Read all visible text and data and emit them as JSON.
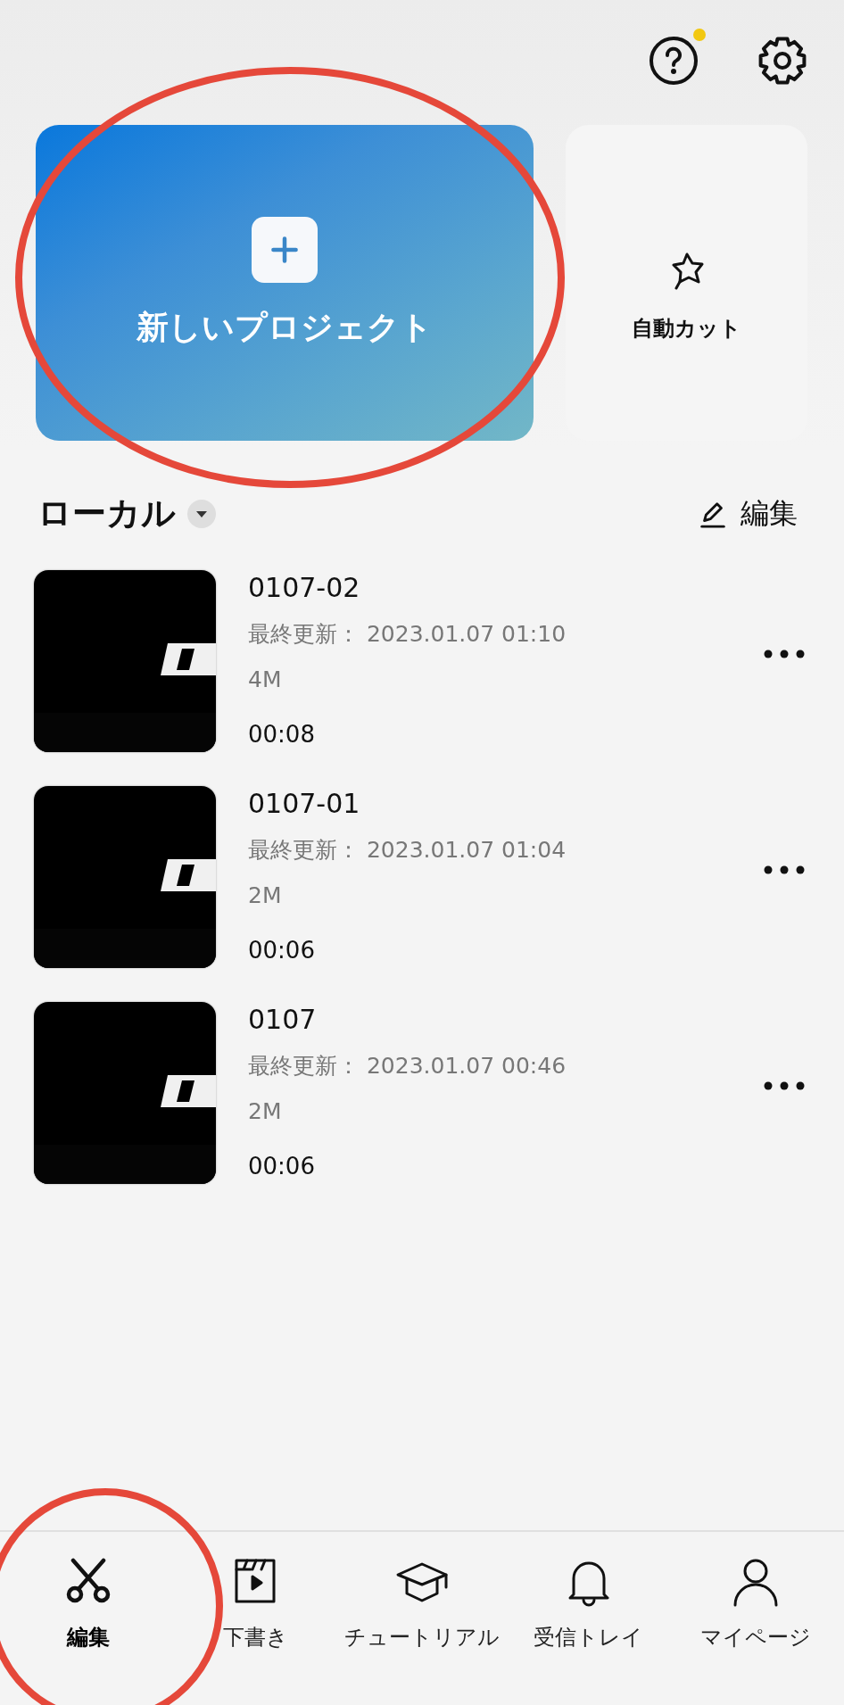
{
  "header": {
    "help_badge": true
  },
  "new_project": {
    "label": "新しいプロジェクト"
  },
  "auto_cut": {
    "label": "自動カット"
  },
  "section": {
    "title": "ローカル",
    "edit": "編集"
  },
  "projects": [
    {
      "name": "0107-02",
      "updated_label": "最終更新：",
      "updated": "2023.01.07 01:10",
      "size": "4M",
      "duration": "00:08"
    },
    {
      "name": "0107-01",
      "updated_label": "最終更新：",
      "updated": "2023.01.07 01:04",
      "size": "2M",
      "duration": "00:06"
    },
    {
      "name": "0107",
      "updated_label": "最終更新：",
      "updated": "2023.01.07 00:46",
      "size": "2M",
      "duration": "00:06"
    }
  ],
  "tab_bar": [
    {
      "label": "編集",
      "kind": "scissors",
      "selected": true
    },
    {
      "label": "下書き",
      "kind": "draft",
      "selected": false
    },
    {
      "label": "チュートリアル",
      "kind": "cap",
      "selected": false
    },
    {
      "label": "受信トレイ",
      "kind": "bell",
      "selected": false
    },
    {
      "label": "マイページ",
      "kind": "person",
      "selected": false
    }
  ],
  "annotations": [
    {
      "kind": "ellipse"
    },
    {
      "kind": "circle"
    }
  ]
}
